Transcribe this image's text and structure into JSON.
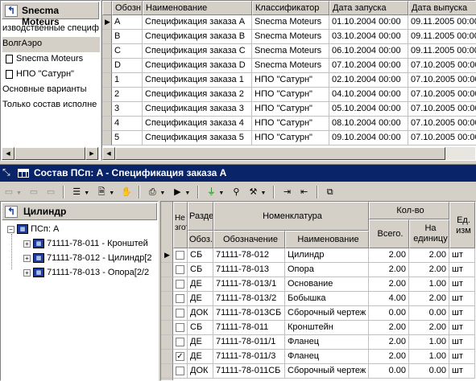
{
  "top_left": {
    "title": "Snecma Moteurs",
    "items": [
      "изводственные специф",
      "ВолгАэро",
      "Snecma Moteurs",
      "НПО \"Сатурн\"",
      "Основные варианты",
      "Только состав исполне"
    ]
  },
  "orders": {
    "columns": [
      "Обозн",
      "Наименование",
      "Классификатор",
      "Дата запуска",
      "Дата выпуска"
    ],
    "rows": [
      [
        "A",
        "Спецификация заказа A",
        "Snecma Moteurs",
        "01.10.2004 00:00",
        "09.11.2005 00:00"
      ],
      [
        "B",
        "Спецификация заказа B",
        "Snecma Moteurs",
        "03.10.2004 00:00",
        "09.11.2005 00:00"
      ],
      [
        "C",
        "Спецификация заказа C",
        "Snecma Moteurs",
        "06.10.2004 00:00",
        "09.11.2005 00:00"
      ],
      [
        "D",
        "Спецификация заказа D",
        "Snecma Moteurs",
        "07.10.2004 00:00",
        "07.10.2005 00:00"
      ],
      [
        "1",
        "Спецификация заказа 1",
        "НПО \"Сатурн\"",
        "02.10.2004 00:00",
        "07.10.2005 00:00"
      ],
      [
        "2",
        "Спецификация заказа 2",
        "НПО \"Сатурн\"",
        "04.10.2004 00:00",
        "07.10.2005 00:00"
      ],
      [
        "3",
        "Спецификация заказа 3",
        "НПО \"Сатурн\"",
        "05.10.2004 00:00",
        "07.10.2005 00:00"
      ],
      [
        "4",
        "Спецификация заказа 4",
        "НПО \"Сатурн\"",
        "08.10.2004 00:00",
        "07.10.2005 00:00"
      ],
      [
        "5",
        "Спецификация заказа 5",
        "НПО \"Сатурн\"",
        "09.10.2004 00:00",
        "07.10.2005 00:00"
      ]
    ]
  },
  "composition": {
    "title": "Состав ПСп: A - Спецификация заказа A",
    "tree_title": "Цилиндр",
    "tree_root": "ПСп: A",
    "tree_items": [
      "71111-78-011 - Кронштей",
      "71111-78-012 - Цилиндр[2",
      "71111-78-013 - Опора[2/2"
    ],
    "headers": {
      "ne_zg": "Не згот",
      "razdel": "Разде",
      "nomenklatura": "Номенклатура",
      "kolvo": "Кол-во",
      "ed": "Ед. изм",
      "oboz": "Обоз.",
      "oboznachenie": "Обозначение",
      "naimenovanie": "Наименование",
      "vsego": "Всего.",
      "na_edinicu": "На единицу"
    },
    "rows": [
      {
        "checked": false,
        "oboz": "СБ",
        "code": "71111-78-012",
        "name": "Цилиндр",
        "total": "2.00",
        "per_unit": "2.00",
        "unit": "шт"
      },
      {
        "checked": false,
        "oboz": "СБ",
        "code": "71111-78-013",
        "name": "Опора",
        "total": "2.00",
        "per_unit": "2.00",
        "unit": "шт"
      },
      {
        "checked": false,
        "oboz": "ДЕ",
        "code": "71111-78-013/1",
        "name": "Основание",
        "total": "2.00",
        "per_unit": "1.00",
        "unit": "шт"
      },
      {
        "checked": false,
        "oboz": "ДЕ",
        "code": "71111-78-013/2",
        "name": "Бобышка",
        "total": "4.00",
        "per_unit": "2.00",
        "unit": "шт"
      },
      {
        "checked": false,
        "oboz": "ДОК",
        "code": "71111-78-013СБ",
        "name": "Сборочный чертеж",
        "total": "0.00",
        "per_unit": "0.00",
        "unit": "шт"
      },
      {
        "checked": false,
        "oboz": "СБ",
        "code": "71111-78-011",
        "name": "Кронштейн",
        "total": "2.00",
        "per_unit": "2.00",
        "unit": "шт"
      },
      {
        "checked": false,
        "oboz": "ДЕ",
        "code": "71111-78-011/1",
        "name": "Фланец",
        "total": "2.00",
        "per_unit": "1.00",
        "unit": "шт"
      },
      {
        "checked": true,
        "oboz": "ДЕ",
        "code": "71111-78-011/3",
        "name": "Фланец",
        "total": "2.00",
        "per_unit": "1.00",
        "unit": "шт"
      },
      {
        "checked": false,
        "oboz": "ДОК",
        "code": "71111-78-011СБ",
        "name": "Сборочный чертеж",
        "total": "0.00",
        "per_unit": "0.00",
        "unit": "шт"
      }
    ]
  },
  "colors": {
    "title_bar": "#0a246a",
    "selection": "#000080"
  }
}
